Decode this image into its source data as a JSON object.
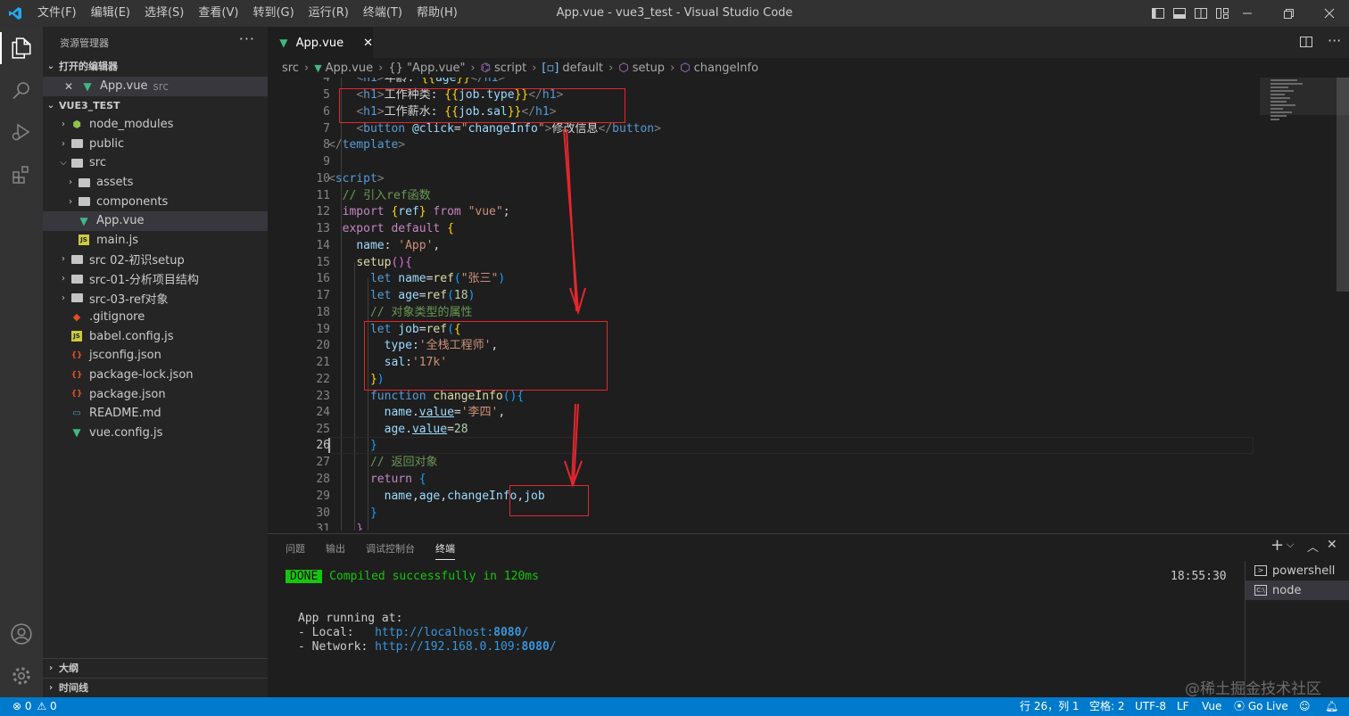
{
  "titlebar": {
    "menus": [
      "文件(F)",
      "编辑(E)",
      "选择(S)",
      "查看(V)",
      "转到(G)",
      "运行(R)",
      "终端(T)",
      "帮助(H)"
    ],
    "window_title": "App.vue - vue3_test - Visual Studio Code"
  },
  "sidebar": {
    "title": "资源管理器",
    "more": "···",
    "open_editors_label": "打开的编辑器",
    "open_editor": {
      "name": "App.vue",
      "dir": "src"
    },
    "project_label": "VUE3_TEST",
    "tree": [
      {
        "name": "node_modules",
        "type": "folder"
      },
      {
        "name": "public",
        "type": "folder"
      },
      {
        "name": "src",
        "type": "folder-open"
      },
      {
        "name": "assets",
        "type": "folder"
      },
      {
        "name": "components",
        "type": "folder"
      },
      {
        "name": "App.vue",
        "type": "vue"
      },
      {
        "name": "main.js",
        "type": "js"
      },
      {
        "name": "src 02-初识setup",
        "type": "folder"
      },
      {
        "name": "src-01-分析项目结构",
        "type": "folder"
      },
      {
        "name": "src-03-ref对象",
        "type": "folder"
      },
      {
        "name": ".gitignore",
        "type": "git"
      },
      {
        "name": "babel.config.js",
        "type": "js"
      },
      {
        "name": "jsconfig.json",
        "type": "json"
      },
      {
        "name": "package-lock.json",
        "type": "json"
      },
      {
        "name": "package.json",
        "type": "json"
      },
      {
        "name": "README.md",
        "type": "md"
      },
      {
        "name": "vue.config.js",
        "type": "vue"
      }
    ],
    "outline_label": "大纲",
    "timeline_label": "时间线"
  },
  "editor": {
    "tab": "App.vue",
    "tab_close": "✕",
    "breadcrumb": [
      "src",
      "App.vue",
      "{} \"App.vue\"",
      "script",
      "default",
      "setup",
      "changeInfo"
    ]
  },
  "panel": {
    "tabs": [
      "问题",
      "输出",
      "调试控制台",
      "终端"
    ],
    "done": "DONE",
    "compiled": "Compiled successfully in 120ms",
    "time": "18:55:30",
    "app_running": "App running at:",
    "local_label": "- Local:   ",
    "local_url_pre": "http://localhost:",
    "local_port": "8080",
    "local_url_post": "/",
    "network_label": "- Network: ",
    "network_url_pre": "http://192.168.0.109:",
    "network_port": "8080",
    "network_url_post": "/",
    "terminals": [
      "powershell",
      "node"
    ]
  },
  "statusbar": {
    "errors": "0",
    "warnings": "0",
    "position": "行 26，列 1",
    "spaces": "空格: 2",
    "encoding": "UTF-8",
    "eol": "LF",
    "language": "Vue",
    "golive": "Go Live"
  },
  "watermark": "@稀土掘金技术社区",
  "colors": {
    "statusbar": "#007acc",
    "annotation": "#e5262d"
  }
}
